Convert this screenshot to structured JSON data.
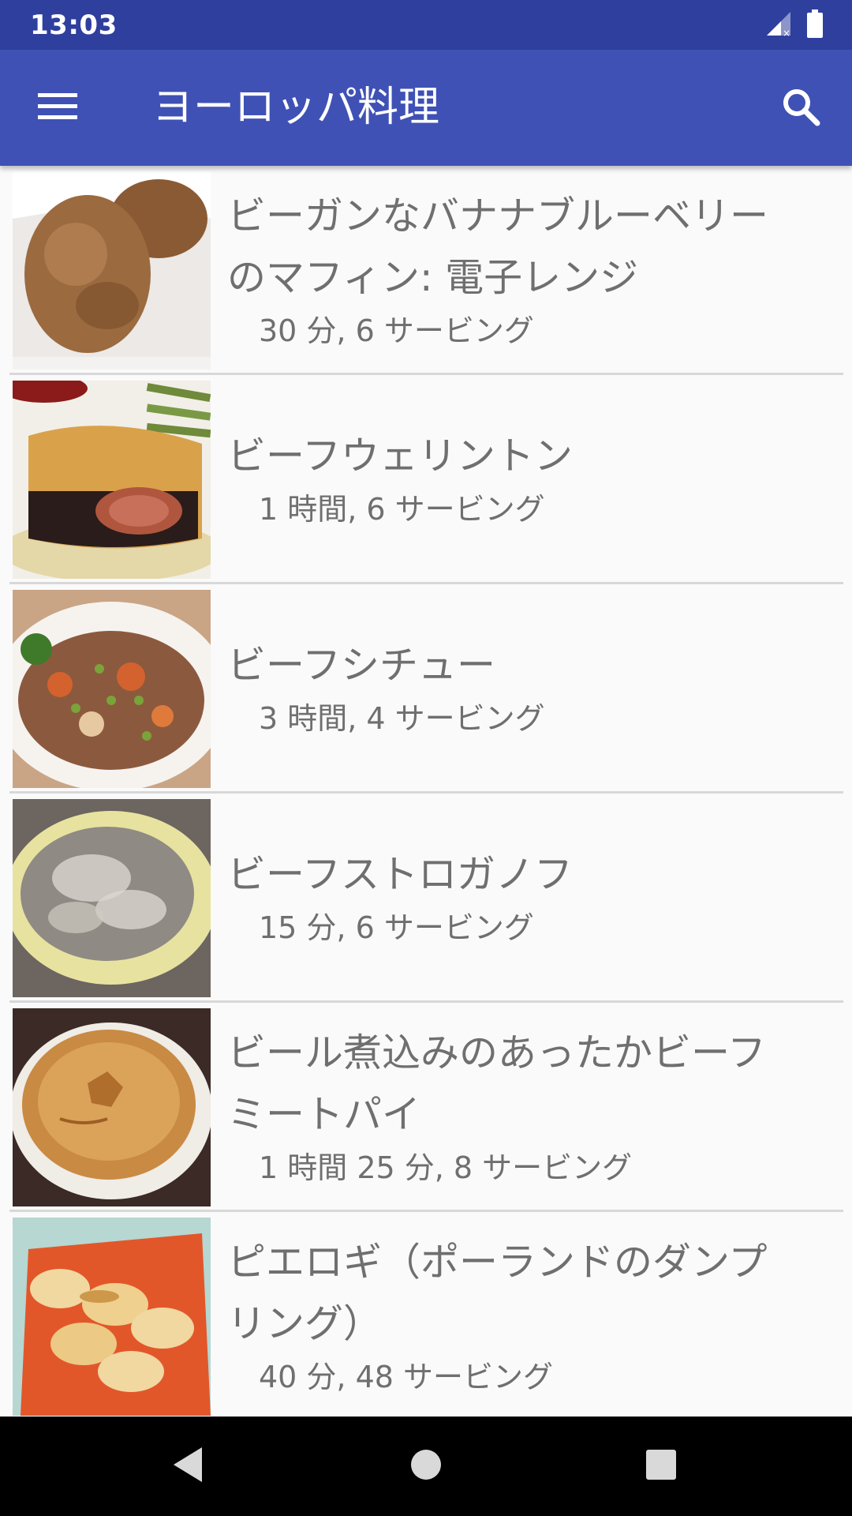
{
  "status_bar": {
    "time": "13:03",
    "icons": [
      "signal-icon",
      "battery-icon"
    ]
  },
  "app_bar": {
    "title": "ヨーロッパ料理",
    "menu_icon": "menu-icon",
    "search_icon": "search-icon"
  },
  "recipes": [
    {
      "title_lines": [
        "ビーガンなバナナブルーベリー",
        "のマフィン: 電子レンジ"
      ],
      "meta": "30 分, 6 サービング"
    },
    {
      "title_lines": [
        "ビーフウェリントン"
      ],
      "meta": "1 時間, 6 サービング"
    },
    {
      "title_lines": [
        "ビーフシチュー"
      ],
      "meta": "3 時間, 4 サービング"
    },
    {
      "title_lines": [
        "ビーフストロガノフ"
      ],
      "meta": "15 分, 6 サービング"
    },
    {
      "title_lines": [
        "ビール煮込みのあったかビーフ",
        "ミートパイ"
      ],
      "meta": "1 時間 25 分, 8 サービング"
    },
    {
      "title_lines": [
        "ピエロギ（ポーランドのダンプ",
        "リング）"
      ],
      "meta": "40 分, 48 サービング"
    }
  ],
  "nav_bar": {
    "back_icon": "back-icon",
    "home_icon": "home-icon",
    "recents_icon": "recents-icon"
  },
  "colors": {
    "status_bar": "#2f3f9e",
    "app_bar": "#3f51b5",
    "background": "#fafafa",
    "text": "#6f6f6f",
    "divider": "#d8d8d8"
  }
}
